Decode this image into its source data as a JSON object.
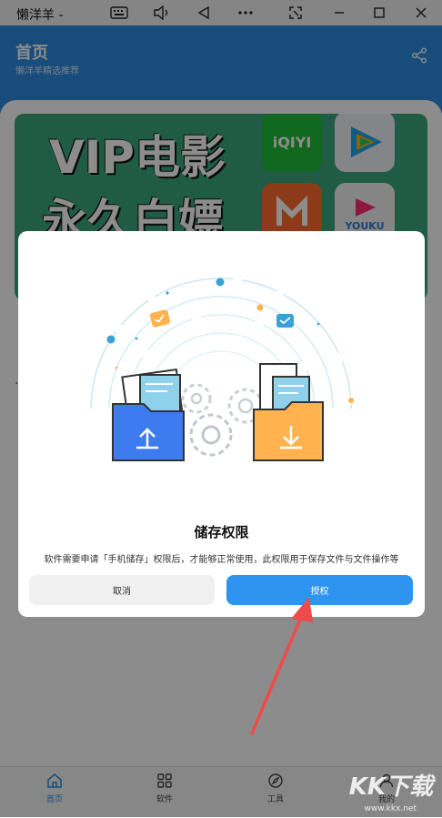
{
  "window": {
    "title": "懒洋羊 -"
  },
  "header": {
    "title": "首页",
    "subtitle": "懒洋羊精选推荐"
  },
  "banner": {
    "line1": "VIP电影",
    "line2": "永久白嫖",
    "apps": [
      "iQIYI",
      "",
      "",
      "YOUKU"
    ]
  },
  "stray_char": "·",
  "dialog": {
    "title": "储存权限",
    "message": "软件需要申请「手机储存」权限后，才能够正常使用，此权限用于保存文件与文件操作等",
    "cancel_label": "取消",
    "confirm_label": "授权"
  },
  "bottom_nav": {
    "items": [
      {
        "label": "首页",
        "icon": "home-icon",
        "active": true
      },
      {
        "label": "软件",
        "icon": "grid-icon",
        "active": false
      },
      {
        "label": "工具",
        "icon": "compass-icon",
        "active": false
      },
      {
        "label": "我的",
        "icon": "user-icon",
        "active": false
      }
    ]
  },
  "watermark": {
    "text": "KK下载",
    "sub": "www.kkx.net"
  },
  "colors": {
    "header": "#2a8be0",
    "accent": "#2d94f0",
    "folder_blue": "#3d7bf0",
    "folder_orange": "#ffb24d"
  }
}
